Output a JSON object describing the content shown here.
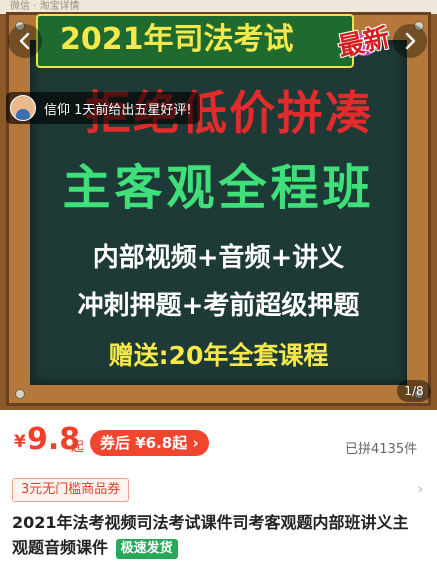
{
  "status_strip": "微信 · 淘宝详情",
  "hero": {
    "banner_title": "2021年司法考试",
    "stamp": "最新",
    "headline_red": "拒绝低价拼凑",
    "headline_green": "主客观全程班",
    "line_1": "内部视频+音频+讲义",
    "line_2": "冲刺押题+考前超级押题",
    "line_3": "赠送:20年全套课程",
    "page_indicator": "1/8"
  },
  "toast": {
    "text": "信仰 1天前给出五星好评!"
  },
  "nav": {
    "back_icon": "chevron-left-icon",
    "share_icon": "chevron-right-icon"
  },
  "price": {
    "currency": "¥",
    "value": "9.8",
    "suffix": "起",
    "after_coupon": "券后 ¥6.8起 ›",
    "sold": "已拼4135件"
  },
  "coupon": {
    "label": "3元无门槛商品券"
  },
  "product": {
    "title": "2021年法考视频司法考试课件司考客观题内部班讲义主观题音频课件",
    "badge": "极速发货"
  },
  "colors": {
    "accent": "#f0402a",
    "board": "#1e3a36",
    "badge": "#2aa85a"
  }
}
